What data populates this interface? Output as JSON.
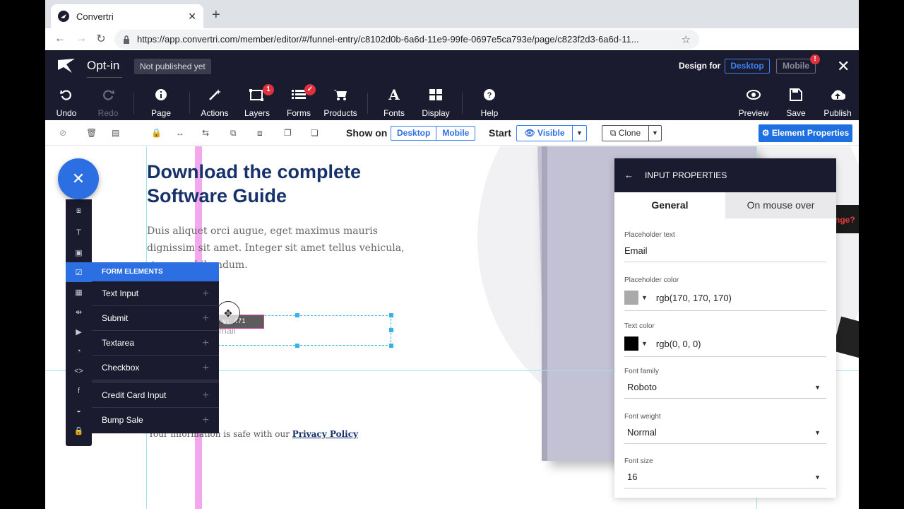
{
  "browser": {
    "tab_title": "Convertri",
    "tab_close": "✕",
    "new_tab": "+",
    "url": "https://app.convertri.com/member/editor/#/funnel-entry/c8102d0b-6a6d-11e9-99fe-0697e5ca793e/page/c823f2d3-6a6d-11..."
  },
  "editor_header": {
    "page_title": "Opt-in",
    "publish_status": "Not published yet",
    "design_for_label": "Design for",
    "design_desktop": "Desktop",
    "design_mobile": "Mobile",
    "mobile_badge": "!",
    "tools_left": [
      {
        "label": "Undo",
        "icon": "undo-icon"
      },
      {
        "label": "Redo",
        "icon": "redo-icon"
      },
      {
        "label": "Page",
        "icon": "info-icon"
      },
      {
        "label": "Actions",
        "icon": "magic-wand-icon"
      },
      {
        "label": "Layers",
        "icon": "layers-icon",
        "badge": "1"
      },
      {
        "label": "Forms",
        "icon": "forms-icon"
      },
      {
        "label": "Products",
        "icon": "cart-icon"
      },
      {
        "label": "Fonts",
        "icon": "font-icon"
      },
      {
        "label": "Display",
        "icon": "grid-icon"
      },
      {
        "label": "Help",
        "icon": "help-icon"
      }
    ],
    "tools_right": [
      {
        "label": "Preview",
        "icon": "eye-icon"
      },
      {
        "label": "Save",
        "icon": "save-icon"
      },
      {
        "label": "Publish",
        "icon": "cloud-upload-icon"
      }
    ]
  },
  "toolbar2": {
    "show_on_label": "Show on",
    "show_desktop": "Desktop",
    "show_mobile": "Mobile",
    "start_label": "Start",
    "visible": "👁 Visible",
    "clone": "⧉ Clone",
    "element_properties": "⚙ Element Properties"
  },
  "canvas": {
    "headline": "Download the complete Software Guide",
    "body": "Duis aliquet orci augue, eget maximus mauris dignissim sit amet. Integer sit amet tellus vehicula, rtor non, bibendum.",
    "email_placeholder": "mail",
    "coords": "y: 471",
    "privacy_prefix": "Your information is safe with our ",
    "privacy_link": "Privacy Policy",
    "book_text": "nge?"
  },
  "sidebar": {
    "fab": "✕",
    "flyout_title": "FORM ELEMENTS",
    "form_elements": [
      "Text Input",
      "Submit",
      "Textarea",
      "Checkbox",
      "Credit Card Input",
      "Bump Sale"
    ]
  },
  "properties": {
    "title": "INPUT PROPERTIES",
    "tab_general": "General",
    "tab_hover": "On mouse over",
    "placeholder_text_label": "Placeholder text",
    "placeholder_text": "Email",
    "placeholder_color_label": "Placeholder color",
    "placeholder_color": "rgb(170, 170, 170)",
    "text_color_label": "Text color",
    "text_color": "rgb(0, 0, 0)",
    "font_family_label": "Font family",
    "font_family": "Roboto",
    "font_weight_label": "Font weight",
    "font_weight": "Normal",
    "font_size_label": "Font size",
    "font_size": "16"
  },
  "colors": {
    "header_bg": "#1a1b2e",
    "accent": "#2b6fe3",
    "headline": "#17316a",
    "badge_red": "#e0313e"
  }
}
